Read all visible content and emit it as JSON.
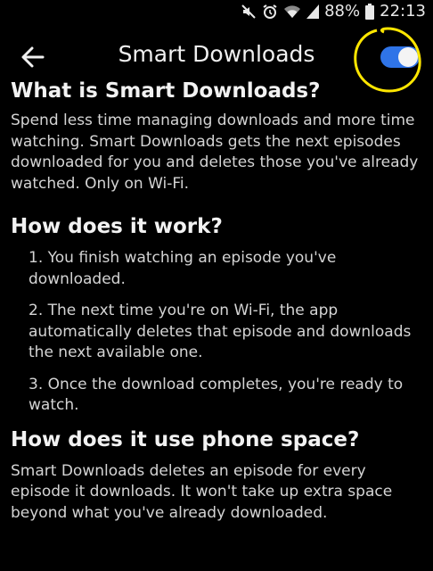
{
  "status_bar": {
    "battery": "88%",
    "time": "22:13"
  },
  "header": {
    "title": "Smart Downloads",
    "toggle_on": true
  },
  "sections": [
    {
      "title": "What is Smart Downloads?",
      "body": "Spend less time managing downloads and more time watching. Smart Downloads gets the next episodes downloaded for you and deletes those you've already watched. Only on Wi-Fi."
    },
    {
      "title": "How does it work?",
      "items": [
        "1. You finish watching an episode you've downloaded.",
        "2. The next time you're on Wi-Fi, the app automatically deletes that episode and downloads the next available one.",
        "3. Once the download completes, you're ready to watch."
      ]
    },
    {
      "title": "How does it use phone space?",
      "body": "Smart Downloads deletes an episode for every episode it downloads. It won't take up extra space beyond what you've already downloaded."
    }
  ],
  "colors": {
    "background": "#000000",
    "toggle_track": "#2f74e8",
    "highlight": "#ffe600"
  }
}
